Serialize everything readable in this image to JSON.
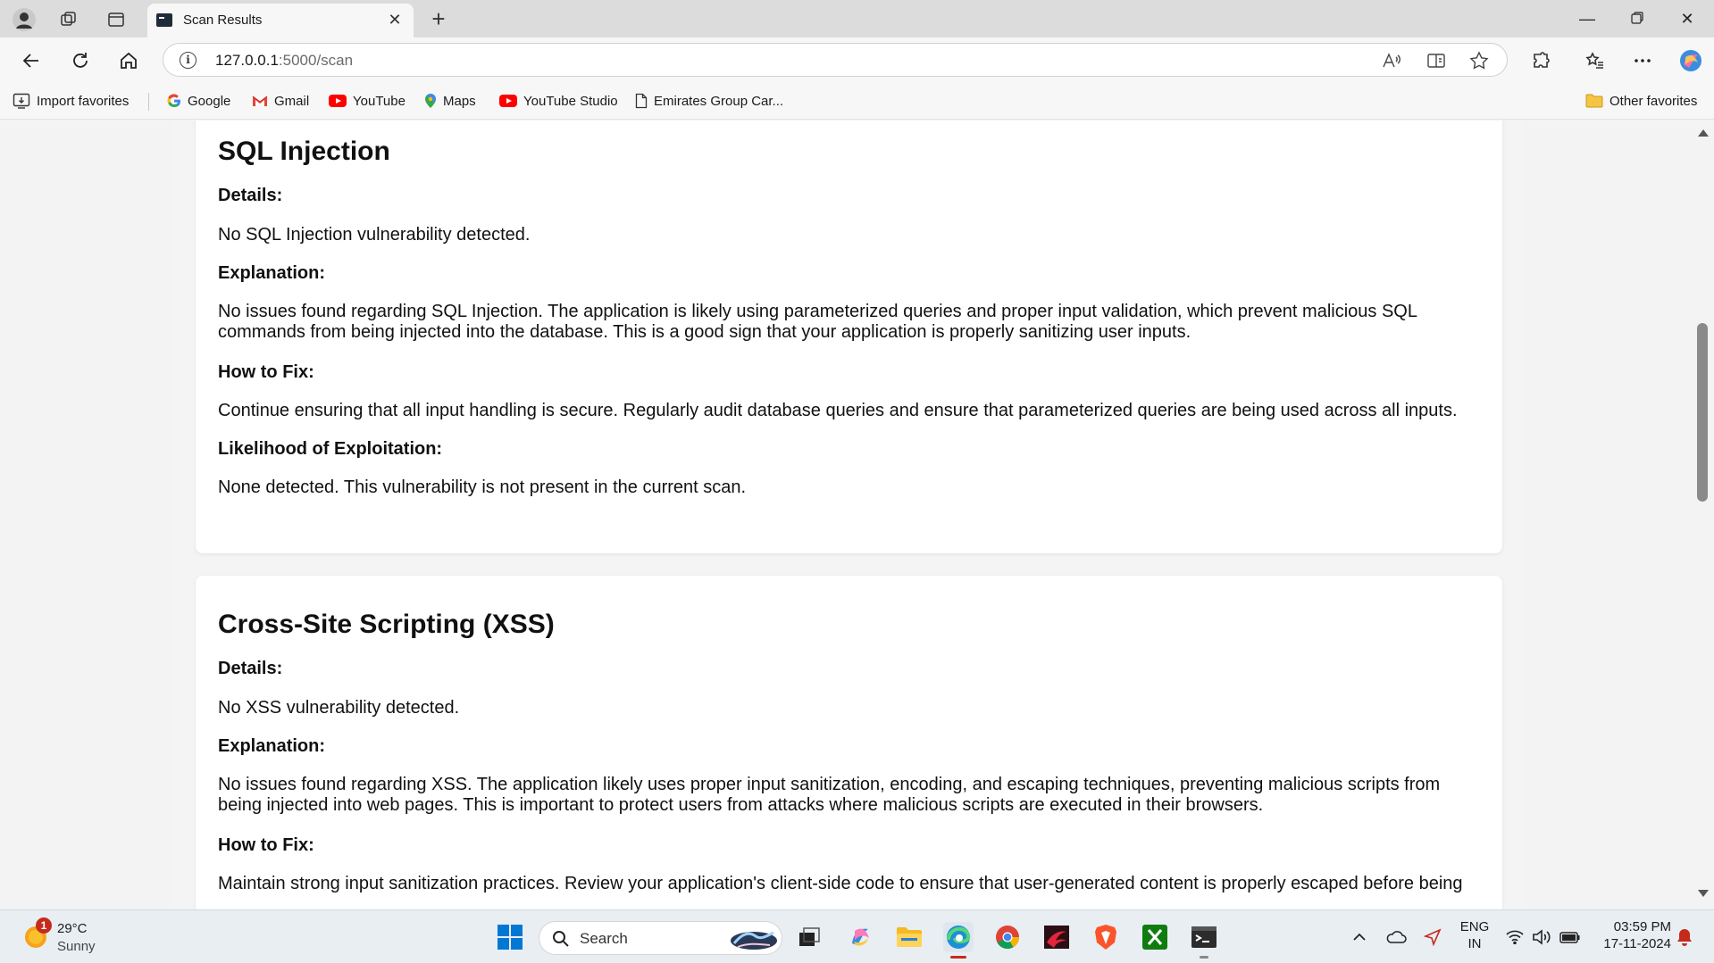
{
  "tab": {
    "title": "Scan Results"
  },
  "address": {
    "host": "127.0.0.1",
    "path": ":5000/scan"
  },
  "favorites": {
    "import": "Import favorites",
    "items": [
      "Google",
      "Gmail",
      "YouTube",
      "Maps",
      "YouTube Studio",
      "Emirates Group Car..."
    ],
    "other": "Other favorites"
  },
  "cards": [
    {
      "title": "SQL Injection",
      "details_label": "Details:",
      "details": "No SQL Injection vulnerability detected.",
      "explanation_label": "Explanation:",
      "explanation": "No issues found regarding SQL Injection. The application is likely using parameterized queries and proper input validation, which prevent malicious SQL commands from being injected into the database. This is a good sign that your application is properly sanitizing user inputs.",
      "fix_label": "How to Fix:",
      "fix": "Continue ensuring that all input handling is secure. Regularly audit database queries and ensure that parameterized queries are being used across all inputs.",
      "likelihood_label": "Likelihood of Exploitation:",
      "likelihood": "None detected. This vulnerability is not present in the current scan."
    },
    {
      "title": "Cross-Site Scripting (XSS)",
      "details_label": "Details:",
      "details": "No XSS vulnerability detected.",
      "explanation_label": "Explanation:",
      "explanation": "No issues found regarding XSS. The application likely uses proper input sanitization, encoding, and escaping techniques, preventing malicious scripts from being injected into web pages. This is important to protect users from attacks where malicious scripts are executed in their browsers.",
      "fix_label": "How to Fix:",
      "fix": "Maintain strong input sanitization practices. Review your application's client-side code to ensure that user-generated content is properly escaped before being"
    }
  ],
  "taskbar": {
    "weather_temp": "29°C",
    "weather_desc": "Sunny",
    "weather_badge": "1",
    "search": "Search",
    "lang": "ENG",
    "region": "IN",
    "time": "03:59 PM",
    "date": "17-11-2024"
  },
  "colors": {
    "accent": "#0078d4",
    "youtube": "#ff0000"
  }
}
